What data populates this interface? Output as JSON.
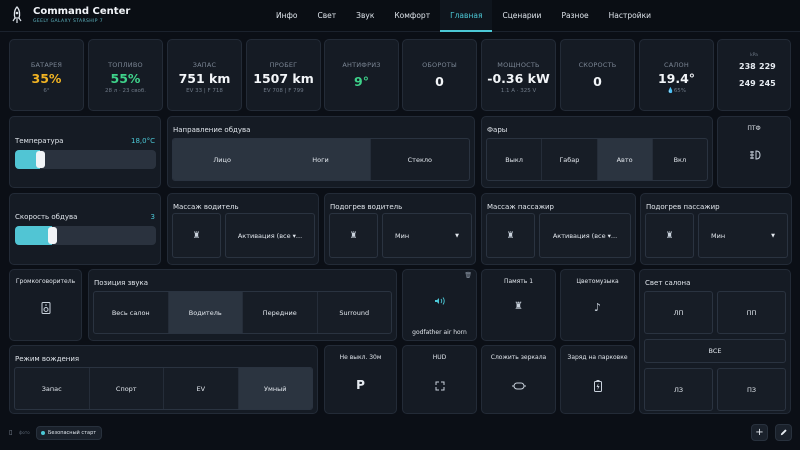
{
  "header": {
    "title": "Command Center",
    "subtitle": "GEELY GALAXY STARSHIP 7",
    "nav": [
      "Инфо",
      "Свет",
      "Звук",
      "Комфорт",
      "Главная",
      "Сценарии",
      "Разное",
      "Настройки"
    ],
    "active_nav": "Главная"
  },
  "stats": {
    "battery": {
      "label": "БАТАРЕЯ",
      "value": "35%",
      "sub": "6°",
      "color": "#f0b323"
    },
    "fuel": {
      "label": "ТОПЛИВО",
      "value": "55%",
      "sub": "28 л · 23 своб.",
      "color": "#3ed28a"
    },
    "range": {
      "label": "ЗАПАС",
      "value": "751 km",
      "sub": "EV 33 | F 718"
    },
    "mileage": {
      "label": "ПРОБЕГ",
      "value": "1507 km",
      "sub": "EV 708 | F 799"
    },
    "antifreeze": {
      "label": "АНТИФРИЗ",
      "value": "9°",
      "color": "#3ed28a"
    },
    "rpm": {
      "label": "ОБОРОТЫ",
      "value": "0"
    },
    "power": {
      "label": "МОЩНОСТЬ",
      "value": "-0.36 kW",
      "sub": "1.1 A · 325 V"
    },
    "speed": {
      "label": "СКОРОСТЬ",
      "value": "0"
    },
    "cabin": {
      "label": "САЛОН",
      "value": "19.4°",
      "sub": "65%"
    },
    "tires": {
      "label": "kPa",
      "fl": "238",
      "fr": "229",
      "rl": "249",
      "rr": "245"
    }
  },
  "temperature": {
    "label": "Температура",
    "value": "18,0°C",
    "level_pct": 18
  },
  "fan": {
    "label": "Скорость обдува",
    "value": "3",
    "level_pct": 26
  },
  "airflow": {
    "title": "Направление обдува",
    "options": [
      "Лицо",
      "Ноги",
      "Стекло"
    ],
    "active": [
      "Лицо",
      "Ноги"
    ]
  },
  "lights": {
    "title": "Фары",
    "options": [
      "Выкл",
      "Габар",
      "Авто",
      "Вкл"
    ],
    "active": "Авто"
  },
  "fog": {
    "label": "ПТФ"
  },
  "massage_driver": {
    "title": "Массаж водитель",
    "mode": "Активация (все ▾..."
  },
  "heat_driver": {
    "title": "Подогрев водитель",
    "level": "Мин"
  },
  "massage_passenger": {
    "title": "Массаж пассажир",
    "mode": "Активация (все ▾..."
  },
  "heat_passenger": {
    "title": "Подогрев пассажир",
    "level": "Мин"
  },
  "speaker": {
    "label": "Громкоговоритель"
  },
  "sound_position": {
    "title": "Позиция звука",
    "options": [
      "Весь салон",
      "Водитель",
      "Передние",
      "Surround"
    ],
    "active": "Водитель"
  },
  "horn": {
    "label": "godfather air horn"
  },
  "memory": {
    "label": "Память 1"
  },
  "color_music": {
    "label": "Цветомузыка"
  },
  "cabin_light": {
    "title": "Свет салона",
    "fl": "ЛП",
    "fr": "ПП",
    "all": "ВСЕ",
    "rl": "ЛЗ",
    "rr": "ПЗ"
  },
  "drive_mode": {
    "title": "Режим вождения",
    "options": [
      "Запас",
      "Спорт",
      "EV",
      "Умный"
    ],
    "active": "Умный"
  },
  "park_hold": {
    "label": "Не выкл. 30м",
    "glyph": "P"
  },
  "hud": {
    "label": "HUD"
  },
  "mirrors": {
    "label": "Сложить зеркала"
  },
  "park_charge": {
    "label": "Заряд на парковке"
  },
  "footer": {
    "small": "фото",
    "safe_start": "Безопасный старт"
  },
  "colors": {
    "accent": "#4cc8d6",
    "bg": "#0b0f16",
    "card": "#151b24",
    "warning": "#f0b323",
    "good": "#3ed28a"
  }
}
